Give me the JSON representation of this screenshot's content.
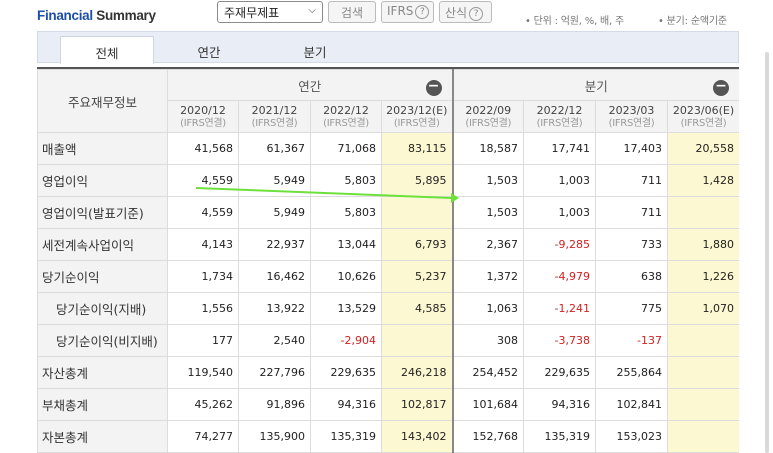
{
  "header": {
    "title_part1": "Financial",
    "title_part2": "Summary",
    "select_value": "주재무제표",
    "search_label": "검색",
    "ifrs_label": "IFRS",
    "formula_label": "산식",
    "help_glyph": "?",
    "unit_text": "• 단위 : 억원, %, 배, 주",
    "basis_text": "• 분기: 순액기준"
  },
  "tabs": [
    "전체",
    "연간",
    "분기"
  ],
  "table": {
    "corner_label": "주요재무정보",
    "annual_label": "연간",
    "quarter_label": "분기",
    "collapse_glyph": "−",
    "columns": [
      {
        "period": "2020/12",
        "basis": "(IFRS연결)"
      },
      {
        "period": "2021/12",
        "basis": "(IFRS연결)"
      },
      {
        "period": "2022/12",
        "basis": "(IFRS연결)"
      },
      {
        "period": "2023/12(E)",
        "basis": "(IFRS연결)"
      },
      {
        "period": "2022/09",
        "basis": "(IFRS연결)"
      },
      {
        "period": "2022/12",
        "basis": "(IFRS연결)"
      },
      {
        "period": "2023/03",
        "basis": "(IFRS연결)"
      },
      {
        "period": "2023/06(E)",
        "basis": "(IFRS연결)"
      }
    ],
    "rows": [
      {
        "label": "매출액",
        "values": [
          "41,568",
          "61,367",
          "71,068",
          "83,115",
          "18,587",
          "17,741",
          "17,403",
          "20,558"
        ]
      },
      {
        "label": "영업이익",
        "values": [
          "4,559",
          "5,949",
          "5,803",
          "5,895",
          "1,503",
          "1,003",
          "711",
          "1,428"
        ]
      },
      {
        "label": "영업이익(발표기준)",
        "values": [
          "4,559",
          "5,949",
          "5,803",
          "",
          "1,503",
          "1,003",
          "711",
          ""
        ]
      },
      {
        "label": "세전계속사업이익",
        "values": [
          "4,143",
          "22,937",
          "13,044",
          "6,793",
          "2,367",
          "-9,285",
          "733",
          "1,880"
        ]
      },
      {
        "label": "당기순이익",
        "values": [
          "1,734",
          "16,462",
          "10,626",
          "5,237",
          "1,372",
          "-4,979",
          "638",
          "1,226"
        ]
      },
      {
        "label": "당기순이익(지배)",
        "values": [
          "1,556",
          "13,922",
          "13,529",
          "4,585",
          "1,063",
          "-1,241",
          "775",
          "1,070"
        ]
      },
      {
        "label": "당기순이익(비지배)",
        "values": [
          "177",
          "2,540",
          "-2,904",
          "",
          "308",
          "-3,738",
          "-137",
          ""
        ]
      },
      {
        "label": "자산총계",
        "values": [
          "119,540",
          "227,796",
          "229,635",
          "246,218",
          "254,452",
          "229,635",
          "255,864",
          ""
        ]
      },
      {
        "label": "부채총계",
        "values": [
          "45,262",
          "91,896",
          "94,316",
          "102,817",
          "101,684",
          "94,316",
          "102,841",
          ""
        ]
      },
      {
        "label": "자본총계",
        "values": [
          "74,277",
          "135,900",
          "135,319",
          "143,402",
          "152,768",
          "135,319",
          "153,023",
          ""
        ]
      }
    ]
  },
  "colors": {
    "accent": "#1d4fa6",
    "estimate_bg": "#fcf8d1",
    "negative": "#d02020",
    "annotation_arrow": "#6ee03c"
  }
}
